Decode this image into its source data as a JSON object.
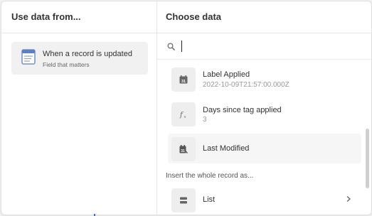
{
  "left_pane": {
    "title": "Use data from...",
    "source": {
      "title": "When a record is updated",
      "subtitle": "Field that matters",
      "icon": "record-update-icon"
    }
  },
  "right_pane": {
    "title": "Choose data",
    "search": {
      "value": "",
      "placeholder": "",
      "icon": "search-icon"
    },
    "fields": [
      {
        "name": "Label Applied",
        "value": "2022-10-09T21:57:00.000Z",
        "icon": "calendar-icon"
      },
      {
        "name": "Days since tag applied",
        "value": "3",
        "icon": "formula-icon"
      },
      {
        "name": "Last Modified",
        "value": "",
        "icon": "calendar-edit-icon"
      }
    ],
    "insert_label": "Insert the whole record as...",
    "insert_options": [
      {
        "name": "List",
        "icon": "list-icon"
      }
    ]
  },
  "colors": {
    "selected_background": "#f1f1f1",
    "hover_background": "#f6f6f6",
    "icon_box": "#eeeeee",
    "text_primary": "#333333",
    "text_secondary": "#999999"
  }
}
